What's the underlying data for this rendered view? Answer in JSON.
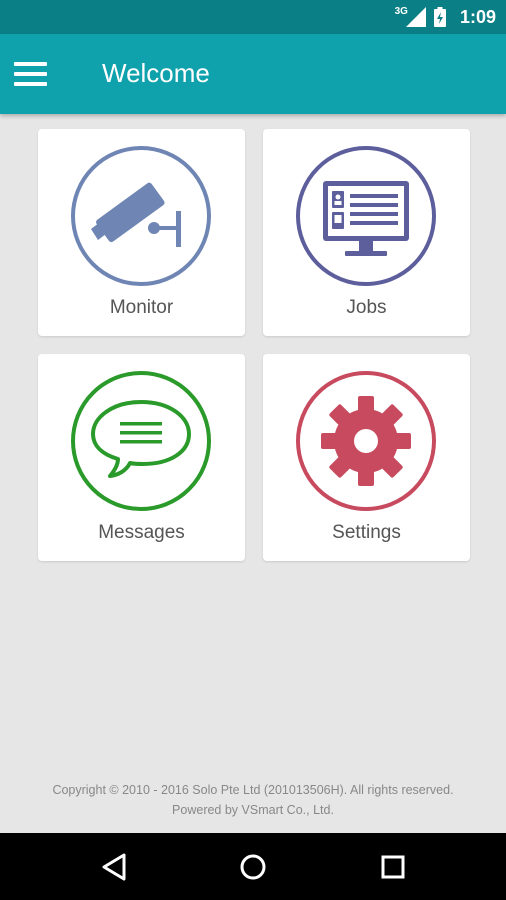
{
  "status_bar": {
    "network": "3G",
    "time": "1:09"
  },
  "app_bar": {
    "title": "Welcome"
  },
  "tiles": [
    {
      "label": "Monitor",
      "icon": "security-camera-icon",
      "color": "#6f86b4"
    },
    {
      "label": "Jobs",
      "icon": "monitor-job-card-icon",
      "color": "#5d5e9c"
    },
    {
      "label": "Messages",
      "icon": "chat-bubble-icon",
      "color": "#2a9a2a"
    },
    {
      "label": "Settings",
      "icon": "gear-icon",
      "color": "#c84a5e"
    }
  ],
  "footer": {
    "copyright": "Copyright © 2010 - 2016 Solo Pte Ltd (201013506H). All rights reserved.",
    "powered_by": "Powered by VSmart Co., Ltd."
  },
  "colors": {
    "status_bar": "#0a7f86",
    "app_bar": "#0fa1ac",
    "background": "#e6e6e6"
  }
}
